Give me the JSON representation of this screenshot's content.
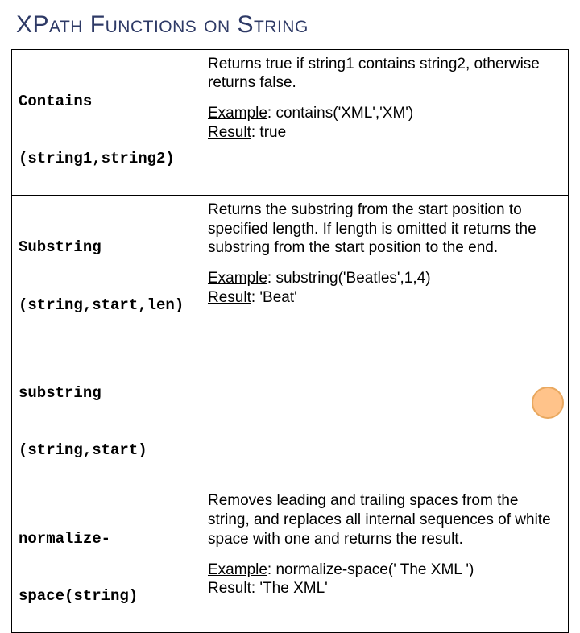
{
  "title": "XPath Functions on String",
  "rows": [
    {
      "fn_line1": "Contains",
      "fn_line2": "(string1,string2)",
      "desc": "Returns true if string1 contains string2, otherwise returns false.",
      "example_label": "Example",
      "example": ": contains('XML','XM')",
      "result_label": "Result",
      "result": ": true"
    },
    {
      "fn_line1": "Substring",
      "fn_line2": "(string,start,len)",
      "fn2_line1": "substring",
      "fn2_line2": "(string,start)",
      "desc": "Returns the substring from the start position to specified length. If length is omitted it returns the substring from the start position to the end.",
      "example_label": "Example",
      "example": ": substring('Beatles',1,4)",
      "result_label": "Result",
      "result": ": 'Beat'"
    },
    {
      "fn_line1": "normalize-",
      "fn_line2": "space(string)",
      "desc": "Removes leading and trailing spaces from the string, and replaces all internal sequences of white space with one and returns the result.",
      "example_label": "Example",
      "example": ": normalize-space(' The   XML ')",
      "result_label": "Result",
      "result": ": 'The XML'"
    }
  ]
}
